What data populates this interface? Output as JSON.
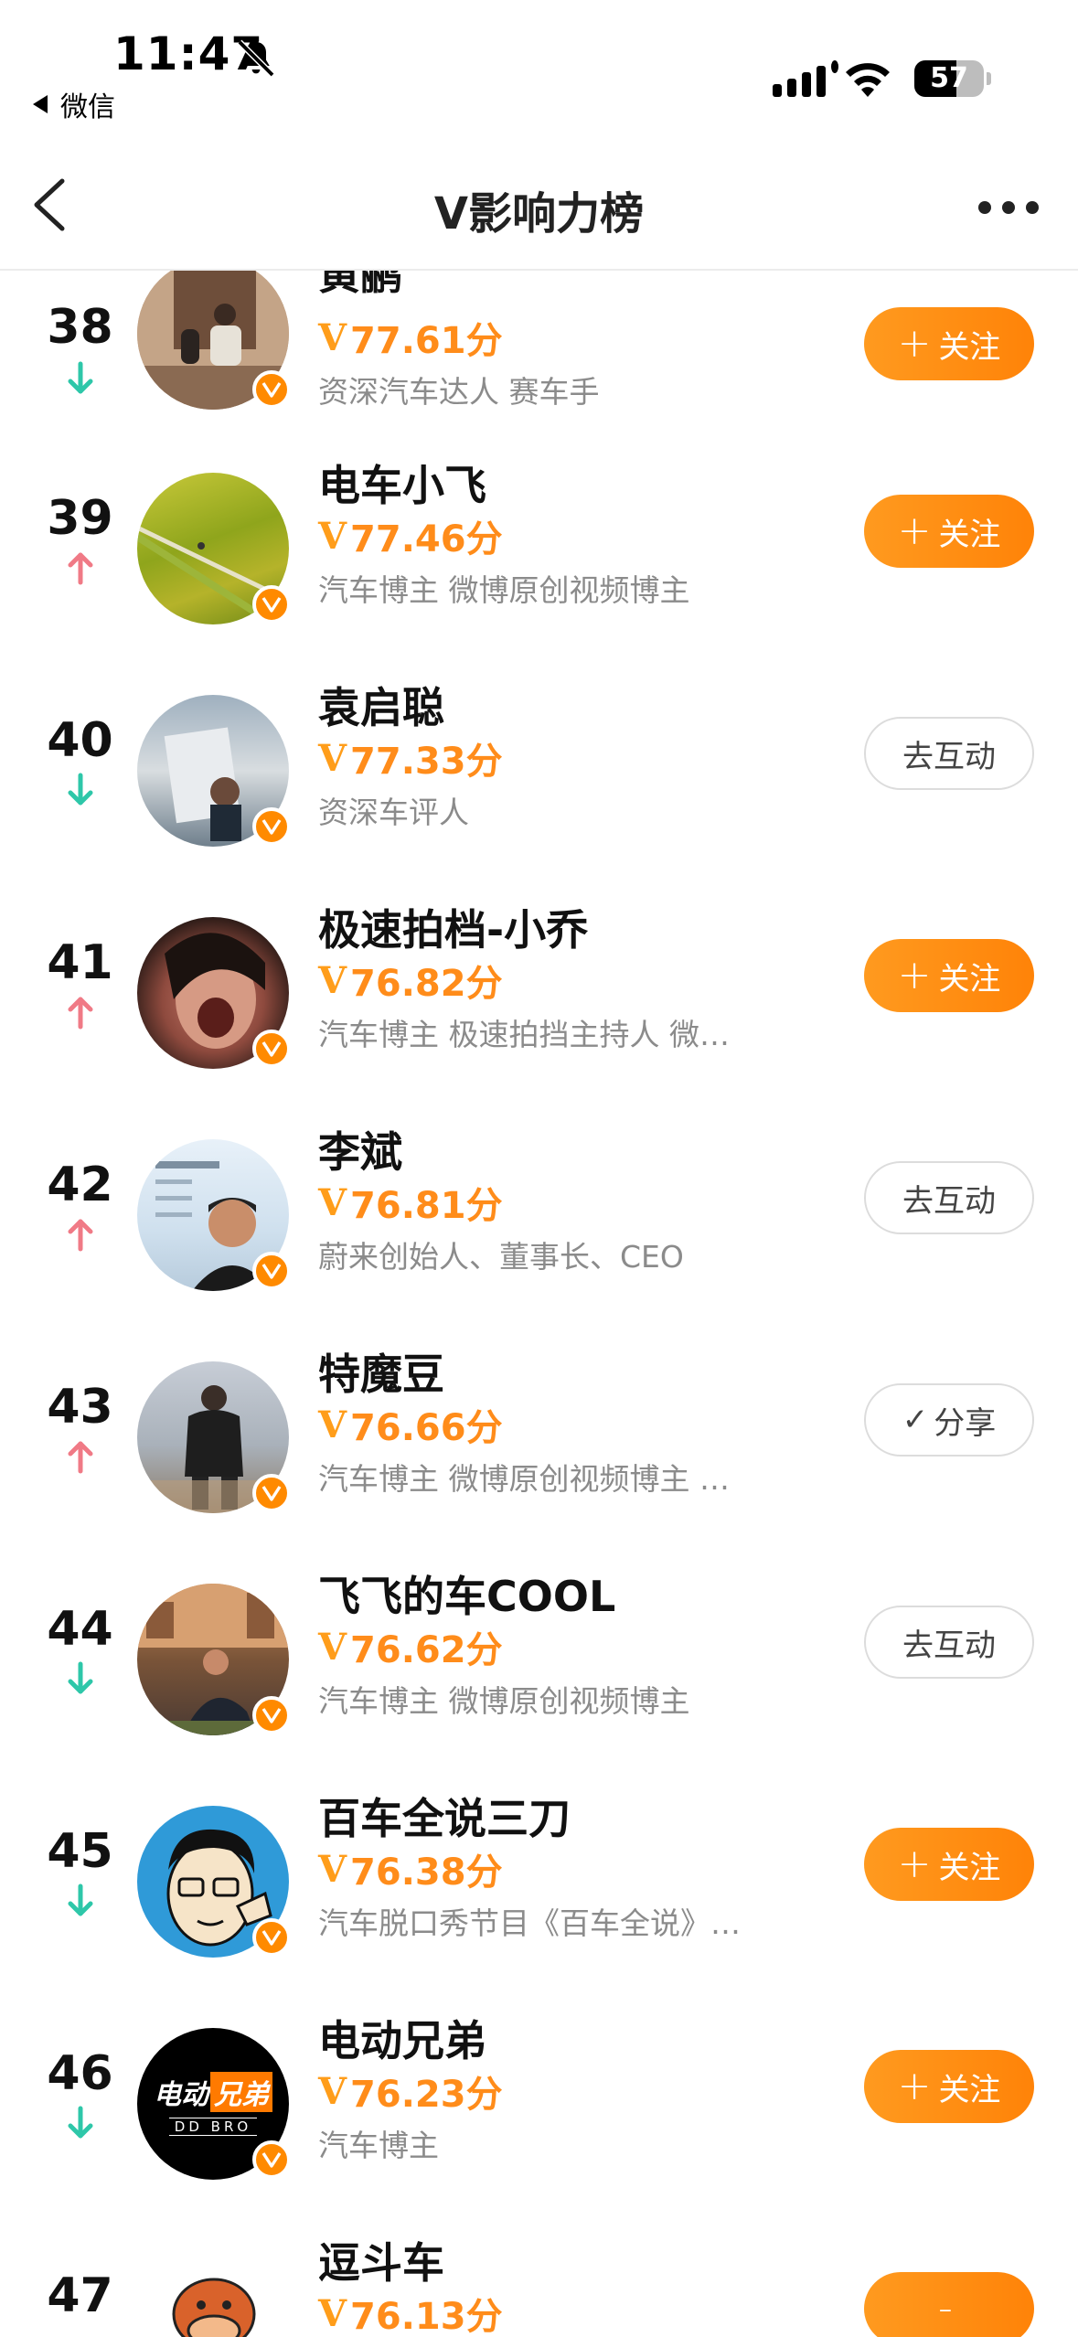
{
  "status_bar": {
    "time": "11:47",
    "back_app": "微信",
    "battery": "57"
  },
  "nav": {
    "title": "V影响力榜"
  },
  "score_prefix": "V",
  "colors": {
    "accent": "#ff8c1a",
    "trend_up": "#f07a86",
    "trend_down": "#2ec7a9",
    "verified_badge": "#ff8a00"
  },
  "rows": [
    {
      "rank": "38",
      "trend": "down",
      "name": "黄鹂",
      "score": "77.61分",
      "desc": "资深汽车达人 赛车手",
      "button": {
        "type": "follow",
        "label": "关注"
      }
    },
    {
      "rank": "39",
      "trend": "up",
      "name": "电车小飞",
      "score": "77.46分",
      "desc": "汽车博主 微博原创视频博主",
      "button": {
        "type": "follow",
        "label": "关注"
      }
    },
    {
      "rank": "40",
      "trend": "down",
      "name": "袁启聪",
      "score": "77.33分",
      "desc": "资深车评人",
      "button": {
        "type": "interact",
        "label": "去互动"
      }
    },
    {
      "rank": "41",
      "trend": "up",
      "name": "极速拍档-小乔",
      "score": "76.82分",
      "desc": "汽车博主 极速拍挡主持人 微…",
      "button": {
        "type": "follow",
        "label": "关注"
      }
    },
    {
      "rank": "42",
      "trend": "up",
      "name": "李斌",
      "score": "76.81分",
      "desc": "蔚来创始人、董事长、CEO",
      "button": {
        "type": "interact",
        "label": "去互动"
      }
    },
    {
      "rank": "43",
      "trend": "up",
      "name": "特魔豆",
      "score": "76.66分",
      "desc": "汽车博主 微博原创视频博主 …",
      "button": {
        "type": "share",
        "label": "分享"
      }
    },
    {
      "rank": "44",
      "trend": "down",
      "name": "飞飞的车COOL",
      "score": "76.62分",
      "desc": "汽车博主 微博原创视频博主",
      "button": {
        "type": "interact",
        "label": "去互动"
      }
    },
    {
      "rank": "45",
      "trend": "down",
      "name": "百车全说三刀",
      "score": "76.38分",
      "desc": "汽车脱口秀节目《百车全说》…",
      "button": {
        "type": "follow",
        "label": "关注"
      }
    },
    {
      "rank": "46",
      "trend": "down",
      "name": "电动兄弟",
      "score": "76.23分",
      "desc": "汽车博主",
      "button": {
        "type": "follow",
        "label": "关注"
      }
    },
    {
      "rank": "47",
      "trend": "",
      "name": "逗斗车",
      "score": "76.13分",
      "desc": "",
      "button": {
        "type": "follow",
        "label": ""
      }
    }
  ],
  "avatar_46": {
    "line1a": "电动",
    "line1b": "兄弟",
    "line2": "DD BRO"
  }
}
